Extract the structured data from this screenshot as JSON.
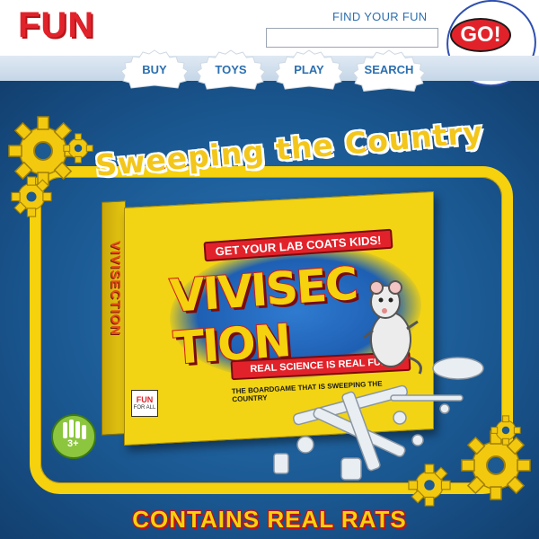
{
  "header": {
    "logo": "FUN",
    "search_label": "FIND YOUR FUN",
    "search_value": "",
    "search_placeholder": "",
    "go_label": "GO!"
  },
  "nav": {
    "items": [
      {
        "label": "BUY"
      },
      {
        "label": "TOYS"
      },
      {
        "label": "PLAY"
      },
      {
        "label": "SEARCH"
      }
    ]
  },
  "banner": {
    "headline": "Sweeping the Country",
    "bottom_text": "CONTAINS REAL RATS"
  },
  "product_box": {
    "side_title": "VIVISECTION",
    "top_banner": "GET YOUR LAB COATS KIDS!",
    "title": "VIVISEC TION",
    "bottom_banner": "REAL SCIENCE IS REAL FUN!",
    "tagline": "THE BOARDGAME THAT IS SWEEPING THE COUNTRY",
    "brand_logo_line1": "FUN",
    "brand_logo_line2": "FOR ALL",
    "age_badge": "3+"
  },
  "colors": {
    "brand_red": "#e2222a",
    "accent_yellow": "#f5d10e",
    "link_blue": "#2b6fb0",
    "background_blue": "#1c5a91"
  },
  "icons": {
    "gear": "gear-icon",
    "hand_badge": "hand-icon",
    "rat": "rat-icon"
  }
}
